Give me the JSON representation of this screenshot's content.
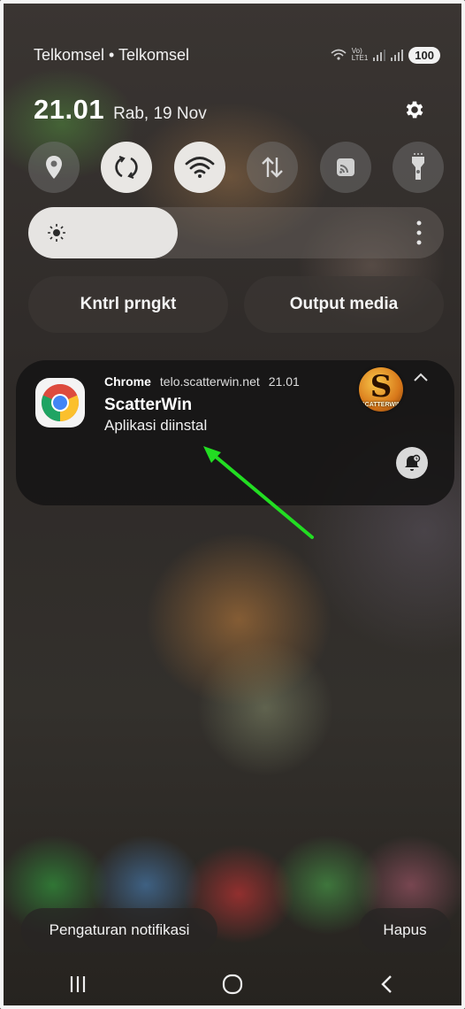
{
  "status_bar": {
    "carrier": "Telkomsel • Telkomsel",
    "network_label_top": "Vo)",
    "network_label_bottom": "LTE1",
    "battery": "100"
  },
  "header": {
    "time": "21.01",
    "date": "Rab, 19 Nov"
  },
  "quick_settings": [
    {
      "name": "location",
      "icon": "location-pin-icon",
      "active": false
    },
    {
      "name": "auto-rotate",
      "icon": "rotate-icon",
      "active": true
    },
    {
      "name": "wifi",
      "icon": "wifi-icon",
      "active": true
    },
    {
      "name": "mobile-data",
      "icon": "data-arrows-icon",
      "active": false
    },
    {
      "name": "cast",
      "icon": "cast-icon",
      "active": false
    },
    {
      "name": "flashlight",
      "icon": "flashlight-icon",
      "active": false
    }
  ],
  "brightness": {
    "level": 0.36
  },
  "pills": {
    "device_control": "Kntrl prngkt",
    "media_output": "Output media"
  },
  "notification": {
    "app": "Chrome",
    "source": "telo.scatterwin.net",
    "time": "21.01",
    "title": "ScatterWin",
    "body": "Aplikasi diinstal",
    "large_icon_letter": "S",
    "large_icon_brand": "SCATTERWIN"
  },
  "footer": {
    "settings_label": "Pengaturan notifikasi",
    "clear_label": "Hapus"
  },
  "colors": {
    "annotation_arrow": "#22dd22",
    "active_tile": "#e9e7e4"
  }
}
